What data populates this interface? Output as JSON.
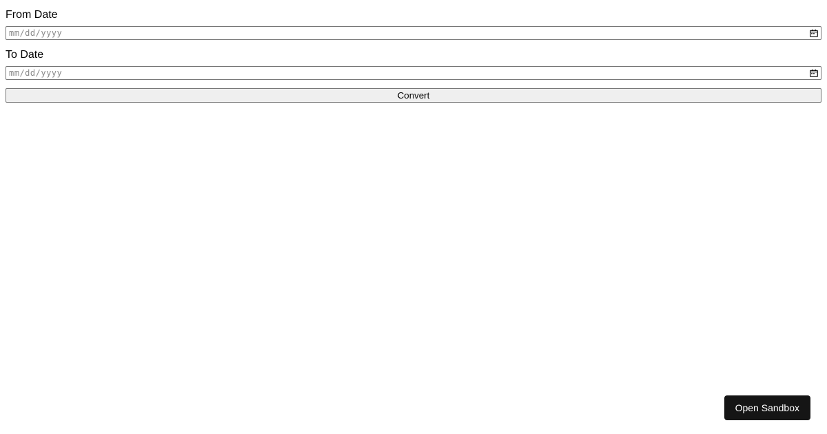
{
  "form": {
    "fromDate": {
      "label": "From Date",
      "placeholder": "mm/dd/yyyy",
      "value": ""
    },
    "toDate": {
      "label": "To Date",
      "placeholder": "mm/dd/yyyy",
      "value": ""
    },
    "convertButton": {
      "label": "Convert"
    }
  },
  "openSandbox": {
    "label": "Open Sandbox"
  }
}
